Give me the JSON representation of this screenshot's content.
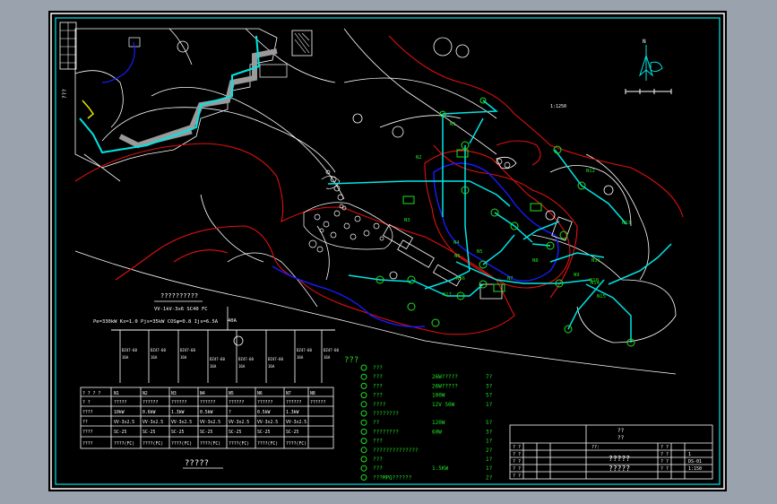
{
  "sheet": {
    "north_label": "N",
    "scale_bar_label": "1:1250",
    "vertical_tag": "???"
  },
  "site_labels": {
    "pole_codes": [
      "N1",
      "N2",
      "N3",
      "N4",
      "N5",
      "N6",
      "N7",
      "N8",
      "N9",
      "N10",
      "N11",
      "N12",
      "N13",
      "N14",
      "N15",
      "N16",
      "N17"
    ]
  },
  "distribution": {
    "title": "??????????",
    "cable": "VV-1kV-3x6 SC40 FC",
    "params": "Pe=330kW  Kx=1.0  Pjs=35kW  COSφ=0.8  Ijs=6.5A",
    "main_breaker": "40A",
    "branch_labels": [
      "N1",
      "N2",
      "N3",
      "N4",
      "N5",
      "N6",
      "N7",
      "N8"
    ]
  },
  "circuit_table": {
    "header": [
      "? ? ? ?",
      "N1",
      "N2",
      "N3",
      "N4",
      "N5",
      "N6",
      "N7",
      "N8"
    ],
    "rows": [
      [
        "? ?",
        "?????",
        "??????",
        "??????",
        "??????",
        "??????",
        "??????",
        "??????",
        "??????"
      ],
      [
        "????",
        "10kW",
        "0.6kW",
        "1.3kW",
        "0.5kW",
        "?",
        "0.5kW",
        "1.3kW",
        ""
      ],
      [
        "??",
        "VV-3x2.5",
        "VV-3x2.5",
        "VV-3x2.5",
        "VV-3x2.5",
        "VV-3x2.5",
        "VV-3x2.5",
        "VV-3x2.5",
        ""
      ],
      [
        "????",
        "SC-25",
        "SC-25",
        "SC-25",
        "SC-25",
        "SC-25",
        "SC-25",
        "SC-25",
        ""
      ],
      [
        "????",
        "????(FC)",
        "????(FC)",
        "????(FC)",
        "????(FC)",
        "????(FC)",
        "????(FC)",
        "????(FC)",
        ""
      ]
    ],
    "title": "?????"
  },
  "legend": {
    "title": "???",
    "items": [
      {
        "name": "???",
        "spec": "",
        "qty": ""
      },
      {
        "name": "???",
        "spec": "26W?????",
        "qty": "7?"
      },
      {
        "name": "???",
        "spec": "26W?????",
        "qty": "3?"
      },
      {
        "name": "???",
        "spec": "100W",
        "qty": "5?"
      },
      {
        "name": "????",
        "spec": "12V 50W",
        "qty": "1?"
      },
      {
        "name": "????????",
        "spec": "",
        "qty": ""
      },
      {
        "name": "??",
        "spec": "120W",
        "qty": "5?"
      },
      {
        "name": "????????",
        "spec": "60W",
        "qty": "3?"
      },
      {
        "name": "???",
        "spec": "",
        "qty": "1?"
      },
      {
        "name": "??????????????",
        "spec": "",
        "qty": "2?"
      },
      {
        "name": "???",
        "spec": "",
        "qty": "1?"
      },
      {
        "name": "???",
        "spec": "1.5KW",
        "qty": "1?"
      },
      {
        "name": "???MPQ??????",
        "spec": "",
        "qty": "2?"
      }
    ]
  },
  "title_block": {
    "top": "??",
    "top2": "??",
    "left_rows": [
      "? ?",
      "? ?",
      "? ?",
      "? ?",
      "? ?"
    ],
    "mid_tag": "??:",
    "project_name": "?????",
    "project_name2": "?????",
    "right_rows": [
      "? ?",
      "? ?",
      "? ?",
      "? ?"
    ],
    "values": [
      "1",
      "DS-01",
      "1:150"
    ]
  },
  "colors": {
    "frame": "#00e5e5",
    "site": "#ffffff",
    "circuit": "#00e5e5",
    "zone_line": "#e01010",
    "water": "#1a1aff",
    "fixture": "#20e020",
    "label_green": "#20e020",
    "label_yellow": "#e5e500"
  }
}
